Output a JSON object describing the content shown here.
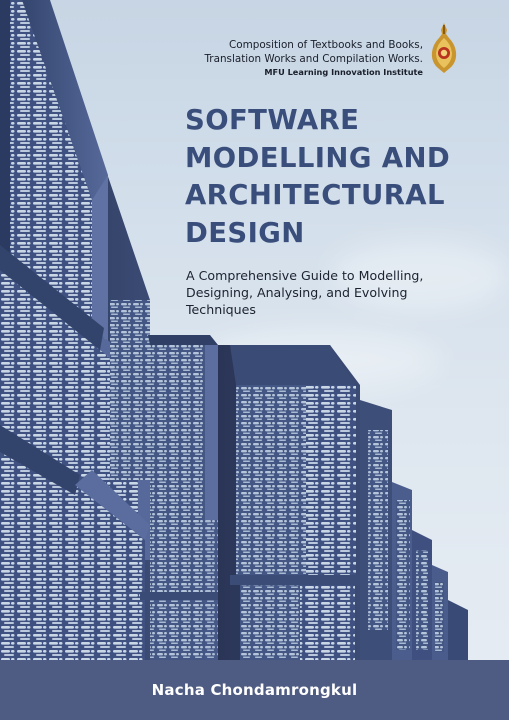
{
  "publisher": {
    "line1": "Composition of Textbooks and Books,",
    "line2": "Translation Works and Compilation Works.",
    "line3": "MFU Learning Innovation Institute"
  },
  "title_lines": [
    "SOFTWARE",
    "MODELLING AND",
    "ARCHITECTURAL",
    "DESIGN"
  ],
  "subtitle_lines": [
    "A Comprehensive Guide to Modelling,",
    "Designing, Analysing, and Evolving",
    "Techniques"
  ],
  "author": "Nacha Chondamrongkul",
  "colors": {
    "title": "#3a4e7c",
    "author_bar": "#4e5b82",
    "sky": "#d3dfeb",
    "facade": "#4a5e8a",
    "emblem_gold": "#c9952e"
  }
}
